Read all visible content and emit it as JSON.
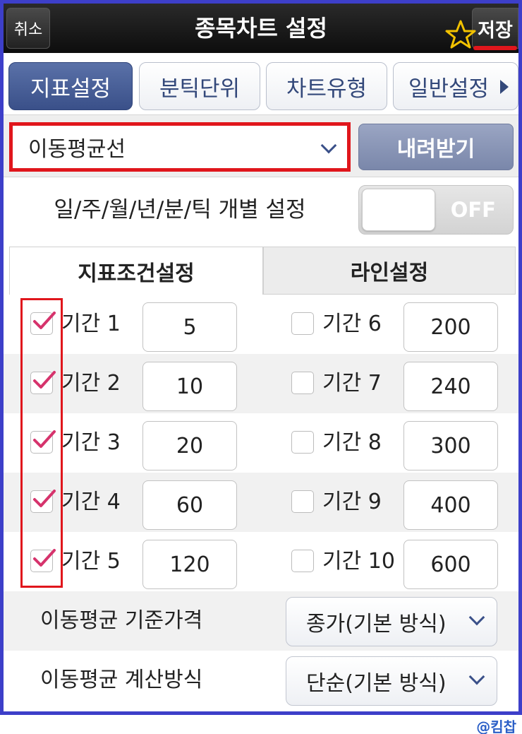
{
  "header": {
    "cancel_label": "취소",
    "title": "종목차트 설정",
    "save_label": "저장"
  },
  "tabs": [
    {
      "label": "지표설정",
      "active": true
    },
    {
      "label": "분틱단위",
      "active": false
    },
    {
      "label": "차트유형",
      "active": false
    },
    {
      "label": "일반설정",
      "active": false
    }
  ],
  "indicator": {
    "selected": "이동평균선",
    "download_label": "내려받기"
  },
  "individual_setting": {
    "label": "일/주/월/년/분/틱 개별 설정",
    "state": "OFF"
  },
  "subtabs": [
    {
      "label": "지표조건설정",
      "active": true
    },
    {
      "label": "라인설정",
      "active": false
    }
  ],
  "periods_left": [
    {
      "label": "기간 1",
      "value": "5",
      "checked": true
    },
    {
      "label": "기간 2",
      "value": "10",
      "checked": true
    },
    {
      "label": "기간 3",
      "value": "20",
      "checked": true
    },
    {
      "label": "기간 4",
      "value": "60",
      "checked": true
    },
    {
      "label": "기간 5",
      "value": "120",
      "checked": true
    }
  ],
  "periods_right": [
    {
      "label": "기간 6",
      "value": "200",
      "checked": false
    },
    {
      "label": "기간 7",
      "value": "240",
      "checked": false
    },
    {
      "label": "기간 8",
      "value": "300",
      "checked": false
    },
    {
      "label": "기간 9",
      "value": "400",
      "checked": false
    },
    {
      "label": "기간 10",
      "value": "600",
      "checked": false
    }
  ],
  "options": [
    {
      "label": "이동평균 기준가격",
      "value": "종가(기본 방식)"
    },
    {
      "label": "이동평균 계산방식",
      "value": "단순(기본 방식)"
    }
  ],
  "watermark": "@킴찹",
  "colors": {
    "frame_border": "#3d3fc9",
    "active_tab": "#3a5089",
    "highlight_red": "#e0161c",
    "checkmark": "#d6336c",
    "star": "#f2c200"
  }
}
